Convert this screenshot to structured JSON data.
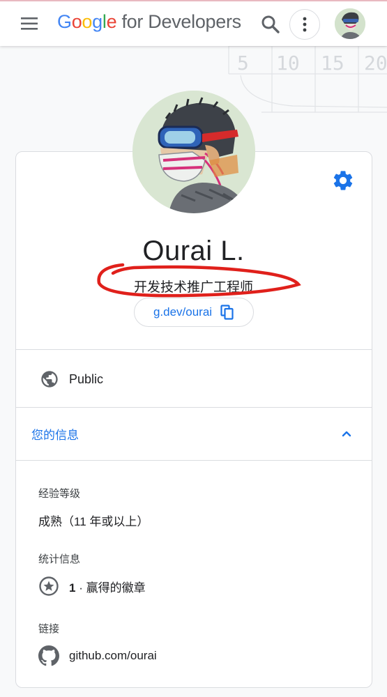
{
  "header": {
    "brand_google": [
      "G",
      "o",
      "o",
      "g",
      "l",
      "e"
    ],
    "brand_suffix": "for Developers",
    "menu_icon": "menu-icon",
    "search_icon": "search-icon",
    "more_icon": "more-vert-icon"
  },
  "background_ruler": {
    "ticks": [
      "5",
      "10",
      "15",
      "20"
    ]
  },
  "profile": {
    "name": "Ourai L.",
    "title": "开发技术推广工程师",
    "profile_link": "g.dev/ourai",
    "visibility": "Public"
  },
  "info_section": {
    "header": "您的信息",
    "experience_label": "经验等级",
    "experience_value": "成熟（11 年或以上）",
    "stats_label": "统计信息",
    "badge_count": "1",
    "badge_text": " · 赢得的徽章",
    "links_label": "链接",
    "github_link": "github.com/ourai"
  },
  "colors": {
    "accent": "#1a73e8",
    "annotation_red": "#e0201b",
    "border": "#dadce0"
  }
}
